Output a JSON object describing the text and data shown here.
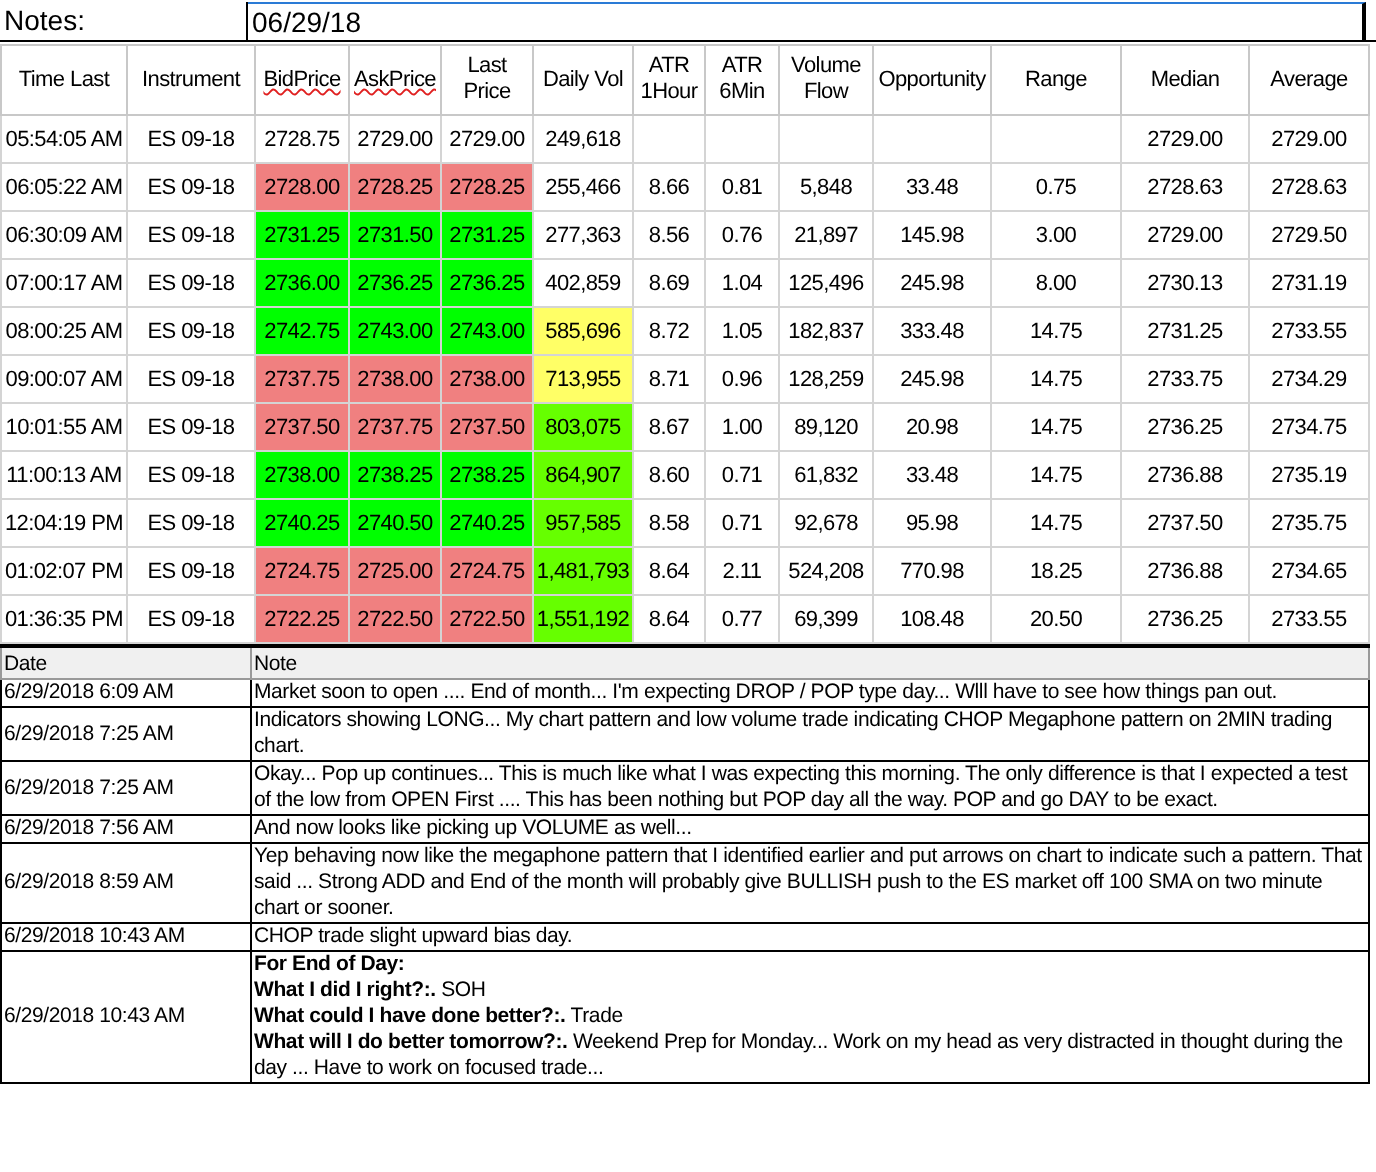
{
  "header": {
    "label": "Notes:",
    "date": "06/29/18"
  },
  "columns": [
    "Time Last",
    "Instrument",
    "BidPrice",
    "AskPrice",
    "Last Price",
    "Daily Vol",
    "ATR 1Hour",
    "ATR 6Min",
    "Volume Flow",
    "Opportunity",
    "Range",
    "Median",
    "Average"
  ],
  "rows": [
    {
      "cells": [
        {
          "text": "05:54:05 AM"
        },
        {
          "text": "ES 09-18"
        },
        {
          "text": "2728.75"
        },
        {
          "text": "2729.00"
        },
        {
          "text": "2729.00"
        },
        {
          "text": "249,618"
        },
        {
          "text": ""
        },
        {
          "text": ""
        },
        {
          "text": ""
        },
        {
          "text": ""
        },
        {
          "text": ""
        },
        {
          "text": "2729.00"
        },
        {
          "text": "2729.00"
        }
      ]
    },
    {
      "cells": [
        {
          "text": "06:05:22 AM"
        },
        {
          "text": "ES 09-18"
        },
        {
          "text": "2728.00",
          "color": "#f08080"
        },
        {
          "text": "2728.25",
          "color": "#f08080"
        },
        {
          "text": "2728.25",
          "color": "#f08080"
        },
        {
          "text": "255,466"
        },
        {
          "text": "8.66"
        },
        {
          "text": "0.81"
        },
        {
          "text": "5,848"
        },
        {
          "text": "33.48"
        },
        {
          "text": "0.75"
        },
        {
          "text": "2728.63"
        },
        {
          "text": "2728.63"
        }
      ]
    },
    {
      "cells": [
        {
          "text": "06:30:09 AM"
        },
        {
          "text": "ES 09-18"
        },
        {
          "text": "2731.25",
          "color": "#00ff00"
        },
        {
          "text": "2731.50",
          "color": "#00ff00"
        },
        {
          "text": "2731.25",
          "color": "#00ff00"
        },
        {
          "text": "277,363"
        },
        {
          "text": "8.56"
        },
        {
          "text": "0.76"
        },
        {
          "text": "21,897"
        },
        {
          "text": "145.98"
        },
        {
          "text": "3.00"
        },
        {
          "text": "2729.00"
        },
        {
          "text": "2729.50"
        }
      ]
    },
    {
      "cells": [
        {
          "text": "07:00:17 AM"
        },
        {
          "text": "ES 09-18"
        },
        {
          "text": "2736.00",
          "color": "#00ff00"
        },
        {
          "text": "2736.25",
          "color": "#00ff00"
        },
        {
          "text": "2736.25",
          "color": "#00ff00"
        },
        {
          "text": "402,859"
        },
        {
          "text": "8.69"
        },
        {
          "text": "1.04"
        },
        {
          "text": "125,496"
        },
        {
          "text": "245.98"
        },
        {
          "text": "8.00"
        },
        {
          "text": "2730.13"
        },
        {
          "text": "2731.19"
        }
      ]
    },
    {
      "cells": [
        {
          "text": "08:00:25 AM"
        },
        {
          "text": "ES 09-18"
        },
        {
          "text": "2742.75",
          "color": "#00ff00"
        },
        {
          "text": "2743.00",
          "color": "#00ff00"
        },
        {
          "text": "2743.00",
          "color": "#00ff00"
        },
        {
          "text": "585,696",
          "color": "#ffff66"
        },
        {
          "text": "8.72"
        },
        {
          "text": "1.05"
        },
        {
          "text": "182,837"
        },
        {
          "text": "333.48"
        },
        {
          "text": "14.75"
        },
        {
          "text": "2731.25"
        },
        {
          "text": "2733.55"
        }
      ]
    },
    {
      "cells": [
        {
          "text": "09:00:07 AM"
        },
        {
          "text": "ES 09-18"
        },
        {
          "text": "2737.75",
          "color": "#f08080"
        },
        {
          "text": "2738.00",
          "color": "#f08080"
        },
        {
          "text": "2738.00",
          "color": "#f08080"
        },
        {
          "text": "713,955",
          "color": "#ffff66"
        },
        {
          "text": "8.71"
        },
        {
          "text": "0.96"
        },
        {
          "text": "128,259"
        },
        {
          "text": "245.98"
        },
        {
          "text": "14.75"
        },
        {
          "text": "2733.75"
        },
        {
          "text": "2734.29"
        }
      ]
    },
    {
      "cells": [
        {
          "text": "10:01:55 AM"
        },
        {
          "text": "ES 09-18"
        },
        {
          "text": "2737.50",
          "color": "#f08080"
        },
        {
          "text": "2737.75",
          "color": "#f08080"
        },
        {
          "text": "2737.50",
          "color": "#f08080"
        },
        {
          "text": "803,075",
          "color": "#66ff00"
        },
        {
          "text": "8.67"
        },
        {
          "text": "1.00"
        },
        {
          "text": "89,120"
        },
        {
          "text": "20.98"
        },
        {
          "text": "14.75"
        },
        {
          "text": "2736.25"
        },
        {
          "text": "2734.75"
        }
      ]
    },
    {
      "cells": [
        {
          "text": "11:00:13 AM"
        },
        {
          "text": "ES 09-18"
        },
        {
          "text": "2738.00",
          "color": "#00ff00"
        },
        {
          "text": "2738.25",
          "color": "#00ff00"
        },
        {
          "text": "2738.25",
          "color": "#00ff00"
        },
        {
          "text": "864,907",
          "color": "#66ff00"
        },
        {
          "text": "8.60"
        },
        {
          "text": "0.71"
        },
        {
          "text": "61,832"
        },
        {
          "text": "33.48"
        },
        {
          "text": "14.75"
        },
        {
          "text": "2736.88"
        },
        {
          "text": "2735.19"
        }
      ]
    },
    {
      "cells": [
        {
          "text": "12:04:19 PM"
        },
        {
          "text": "ES 09-18"
        },
        {
          "text": "2740.25",
          "color": "#00ff00"
        },
        {
          "text": "2740.50",
          "color": "#00ff00"
        },
        {
          "text": "2740.25",
          "color": "#00ff00"
        },
        {
          "text": "957,585",
          "color": "#66ff00"
        },
        {
          "text": "8.58"
        },
        {
          "text": "0.71"
        },
        {
          "text": "92,678"
        },
        {
          "text": "95.98"
        },
        {
          "text": "14.75"
        },
        {
          "text": "2737.50"
        },
        {
          "text": "2735.75"
        }
      ]
    },
    {
      "cells": [
        {
          "text": "01:02:07 PM"
        },
        {
          "text": "ES 09-18"
        },
        {
          "text": "2724.75",
          "color": "#f08080"
        },
        {
          "text": "2725.00",
          "color": "#f08080"
        },
        {
          "text": "2724.75",
          "color": "#f08080"
        },
        {
          "text": "1,481,793",
          "color": "#66ff00"
        },
        {
          "text": "8.64"
        },
        {
          "text": "2.11"
        },
        {
          "text": "524,208"
        },
        {
          "text": "770.98"
        },
        {
          "text": "18.25"
        },
        {
          "text": "2736.88"
        },
        {
          "text": "2734.65"
        }
      ]
    },
    {
      "cells": [
        {
          "text": "01:36:35 PM"
        },
        {
          "text": "ES 09-18"
        },
        {
          "text": "2722.25",
          "color": "#f08080"
        },
        {
          "text": "2722.50",
          "color": "#f08080"
        },
        {
          "text": "2722.50",
          "color": "#f08080"
        },
        {
          "text": "1,551,192",
          "color": "#66ff00"
        },
        {
          "text": "8.64"
        },
        {
          "text": "0.77"
        },
        {
          "text": "69,399"
        },
        {
          "text": "108.48"
        },
        {
          "text": "20.50"
        },
        {
          "text": "2736.25"
        },
        {
          "text": "2733.55"
        }
      ]
    }
  ],
  "notes": {
    "columns": [
      "Date",
      "Note"
    ],
    "rows": [
      {
        "date": "6/29/2018 6:09 AM",
        "lines": [
          "Market soon to open .... End of month... I'm expecting DROP / POP type day... Wlll have to see how things pan out."
        ]
      },
      {
        "date": "6/29/2018 7:25 AM",
        "lines": [
          "Indicators showing LONG... My chart pattern and low volume trade indicating CHOP Megaphone pattern on 2MIN trading chart."
        ]
      },
      {
        "date": "6/29/2018 7:25 AM",
        "lines": [
          "Okay... Pop up continues... This is much like what I was expecting this morning.  The only difference is that I expected a test of the low from OPEN First .... This has been nothing but POP day all the way.  POP and go DAY to be exact."
        ]
      },
      {
        "date": "6/29/2018 7:56 AM",
        "lines": [
          "And now looks like picking up VOLUME as well..."
        ]
      },
      {
        "date": "6/29/2018 8:59 AM",
        "lines": [
          "Yep behaving now like the megaphone pattern that I identified earlier and put arrows on chart to indicate such a pattern.  That said ... Strong ADD and End of the month will probably give BULLISH push to the ES market off 100 SMA on two minute chart or sooner."
        ]
      },
      {
        "date": "6/29/2018 10:43 AM",
        "lines": [
          "CHOP trade slight upward bias day."
        ]
      },
      {
        "date": "6/29/2018 10:43 AM",
        "lines": [
          "**For End of Day:**",
          "**What I did I right?:.** SOH",
          "**What could I have done better?:.** Trade",
          "**What will I do better tomorrow?:.** Weekend Prep for Monday... Work on my head as very distracted in thought during the day ... Have to work on focused trade..."
        ]
      }
    ]
  }
}
